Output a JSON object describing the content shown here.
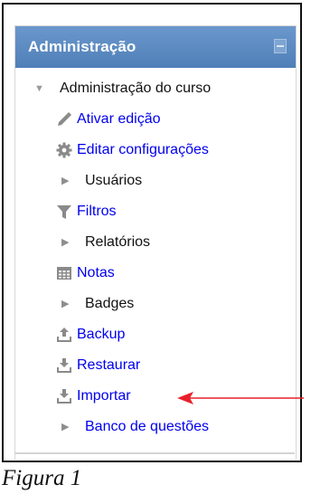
{
  "block": {
    "title": "Administração"
  },
  "tree": {
    "root_label": "Administração do curso",
    "items": [
      {
        "label": "Ativar edição",
        "icon": "pencil-icon"
      },
      {
        "label": "Editar configurações",
        "icon": "gear-icon"
      },
      {
        "label": "Usuários",
        "icon": "expand-triangle-icon"
      },
      {
        "label": "Filtros",
        "icon": "filter-icon"
      },
      {
        "label": "Relatórios",
        "icon": "expand-triangle-icon"
      },
      {
        "label": "Notas",
        "icon": "grades-table-icon"
      },
      {
        "label": "Badges",
        "icon": "expand-triangle-icon"
      },
      {
        "label": "Backup",
        "icon": "backup-upload-icon"
      },
      {
        "label": "Restaurar",
        "icon": "restore-download-icon"
      },
      {
        "label": "Importar",
        "icon": "import-download-icon"
      },
      {
        "label": "Banco de questões",
        "icon": "expand-triangle-icon"
      }
    ]
  },
  "annotation": {
    "arrow_color": "#e8202a"
  },
  "caption": {
    "text": "Figura 1"
  },
  "colors": {
    "header_blue": "#5f8fc5",
    "link_blue": "#0000ee",
    "icon_gray": "#8a8a8a"
  }
}
